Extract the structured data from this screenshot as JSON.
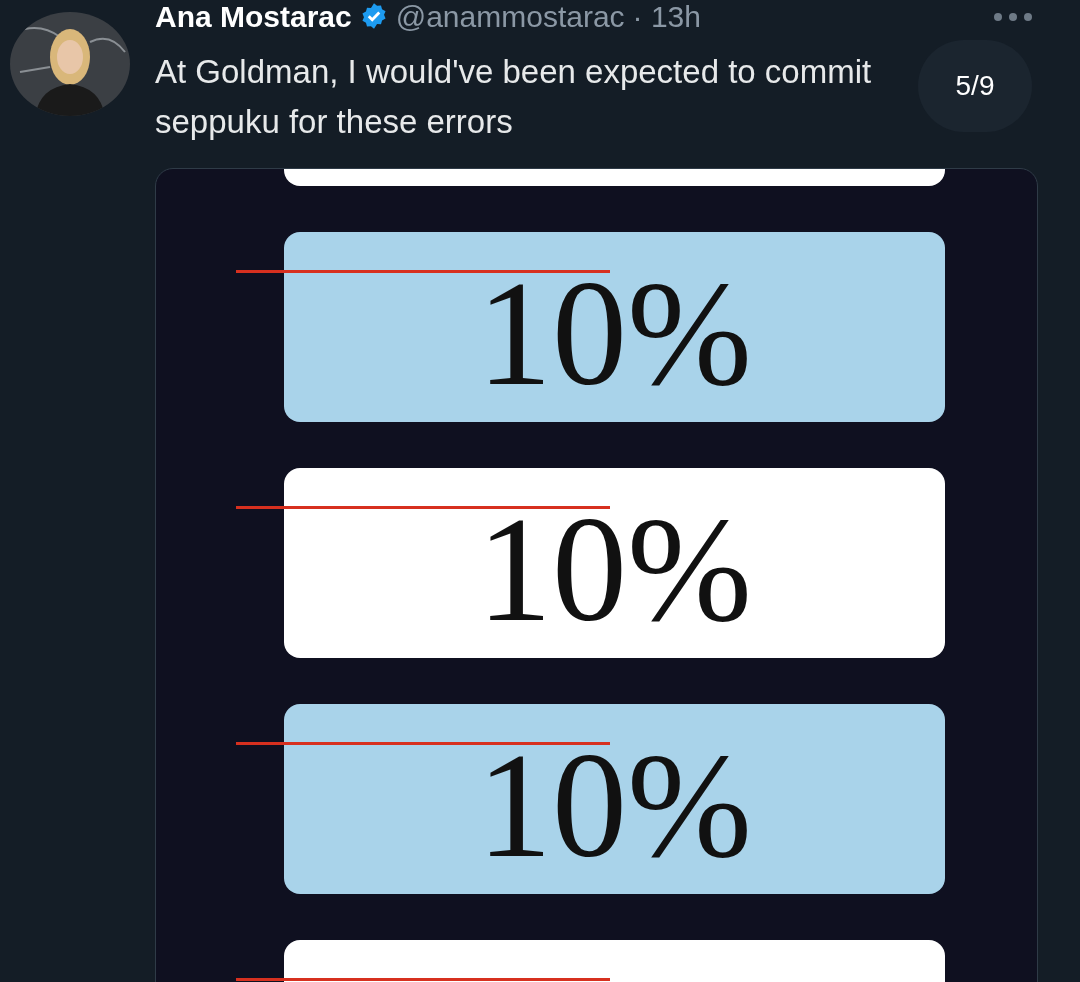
{
  "tweet": {
    "author": "Ana Mostarac",
    "handle": "@anammostarac",
    "time": "· 13h",
    "verified": true,
    "text": "At Goldman, I would've been expected to commit seppuku for these errors",
    "counter": "5/9"
  },
  "image_boxes": [
    {
      "kind": "white"
    },
    {
      "kind": "blue",
      "struck": true,
      "text": "10%"
    },
    {
      "kind": "white",
      "struck": true,
      "text": "10%"
    },
    {
      "kind": "blue",
      "struck": true,
      "text": "10%"
    },
    {
      "kind": "white",
      "struck": true
    }
  ]
}
